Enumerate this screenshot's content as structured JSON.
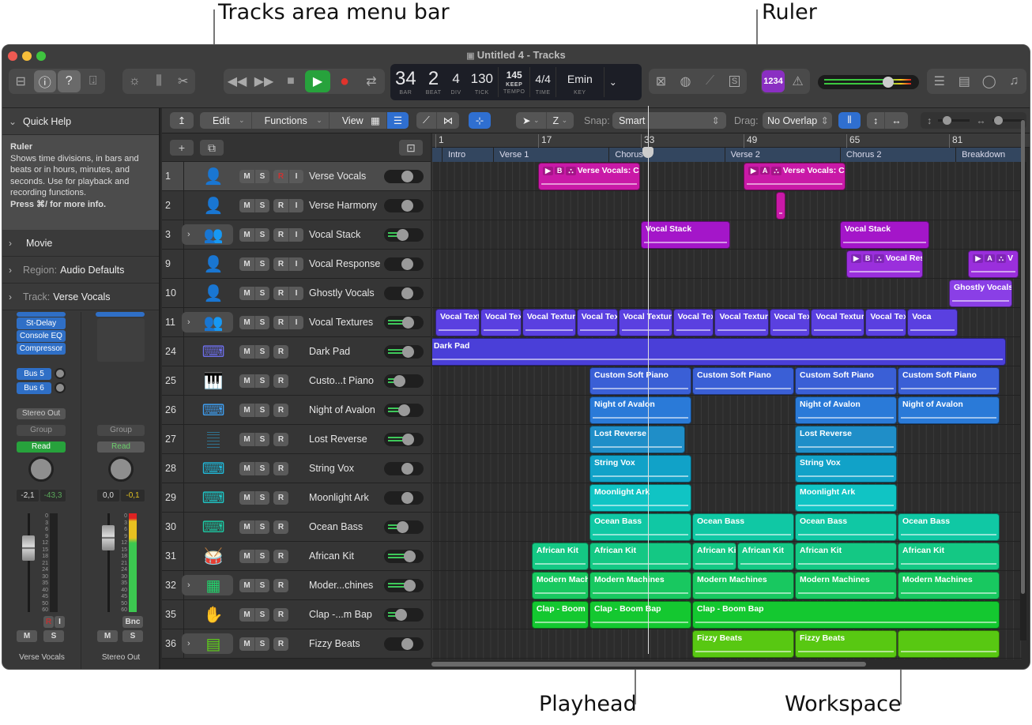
{
  "callouts": {
    "tracks_area_menu_bar": "Tracks area menu bar",
    "ruler": "Ruler",
    "playhead": "Playhead",
    "workspace": "Workspace"
  },
  "window": {
    "title": "Untitled 4 - Tracks"
  },
  "control_bar": {
    "lcd": {
      "bar": "34",
      "bar_label": "BAR",
      "beat": "2",
      "beat_label": "BEAT",
      "div": "4",
      "div_label": "DIV",
      "tick": "130",
      "tick_label": "TICK",
      "tempo": "145",
      "tempo_mode": "KEEP",
      "tempo_label": "TEMPO",
      "time_sig": "4/4",
      "time_label": "TIME",
      "key": "Emin",
      "key_label": "KEY"
    },
    "count_in": "1234",
    "master_level_fraction": 0.68,
    "accent_purple": "#8a2fc2",
    "play_green": "#27a23c",
    "record_red": "#e0332c"
  },
  "inspector": {
    "quick_help": {
      "header": "Quick Help",
      "title": "Ruler",
      "body": "Shows time divisions, in bars and beats or in hours, minutes, and seconds. Use for playback and recording functions.",
      "hint": "Press ⌘/ for more info."
    },
    "sections": [
      {
        "label": "Movie",
        "prefix": ""
      },
      {
        "label": "Audio Defaults",
        "prefix": "Region:"
      },
      {
        "label": "Verse Vocals",
        "prefix": "Track:"
      }
    ],
    "channel_strips": [
      {
        "name": "Verse Vocals",
        "plugins": [
          "St-Delay",
          "Console EQ",
          "Compressor"
        ],
        "sends": [
          "Bus 5",
          "Bus 6"
        ],
        "output": "Stereo Out",
        "group": "Group",
        "automation": "Read",
        "volume": "-2,1",
        "peak": "-43,3",
        "buttons": [
          "R",
          "I",
          "M",
          "S"
        ]
      },
      {
        "name": "Stereo Out",
        "plugins": [],
        "sends": [],
        "group": "Group",
        "automation": "Read",
        "volume": "0,0",
        "peak": "-0,1",
        "buttons": [
          "Bnc",
          "M",
          "S"
        ]
      }
    ],
    "meter_scale": [
      "0",
      "3",
      "6",
      "9",
      "12",
      "15",
      "18",
      "21",
      "24",
      "30",
      "35",
      "40",
      "45",
      "50",
      "60"
    ]
  },
  "tracks_menu": {
    "edit": "Edit",
    "functions": "Functions",
    "view": "View",
    "snap_label": "Snap:",
    "snap_value": "Smart",
    "drag_label": "Drag:",
    "drag_value": "No Overlap",
    "tool_right": "Z"
  },
  "ruler": {
    "bars": [
      "1",
      "17",
      "33",
      "49",
      "65",
      "81"
    ],
    "markers": [
      "Intro",
      "Verse 1",
      "Chorus 1",
      "Verse 2",
      "Chorus 2",
      "Breakdown"
    ]
  },
  "tracks": [
    {
      "num": "1",
      "name": "Verse Vocals",
      "icon": "vocalist-icon",
      "color": "#c418a8",
      "folder": false,
      "rec": true,
      "selected": true,
      "level": 0
    },
    {
      "num": "2",
      "name": "Verse Harmony",
      "icon": "vocalist-icon",
      "color": "#e23ad6",
      "folder": false,
      "rec": true,
      "level": 0
    },
    {
      "num": "3",
      "name": "Vocal Stack",
      "icon": "choir-icon",
      "color": "#c64ce0",
      "folder": true,
      "rec": true,
      "level": 0.5
    },
    {
      "num": "9",
      "name": "Vocal Response",
      "icon": "vocalist-icon",
      "color": "#b45cf0",
      "folder": false,
      "rec": true,
      "level": 0
    },
    {
      "num": "10",
      "name": "Ghostly Vocals",
      "icon": "vocalist-icon",
      "color": "#9a5ef2",
      "folder": false,
      "rec": true,
      "level": 0
    },
    {
      "num": "11",
      "name": "Vocal Textures",
      "icon": "choir-icon",
      "color": "#7a68f0",
      "folder": true,
      "rec": true,
      "level": 0.8
    },
    {
      "num": "24",
      "name": "Dark Pad",
      "icon": "synth-icon",
      "color": "#6c6ee8",
      "folder": false,
      "rec": false,
      "level": 0.8
    },
    {
      "num": "25",
      "name": "Custo...t Piano",
      "icon": "piano-icon",
      "color": "#5a86ee",
      "folder": false,
      "rec": false,
      "level": 0.3
    },
    {
      "num": "26",
      "name": "Night of Avalon",
      "icon": "keyboard-icon",
      "color": "#3f9ef0",
      "folder": false,
      "rec": false,
      "level": 0.6
    },
    {
      "num": "27",
      "name": "Lost Reverse",
      "icon": "sampler-icon",
      "color": "#2aaee8",
      "folder": false,
      "rec": false,
      "level": 0.8
    },
    {
      "num": "28",
      "name": "String Vox",
      "icon": "keyboard-icon",
      "color": "#20b8d8",
      "folder": false,
      "rec": false,
      "level": 0
    },
    {
      "num": "29",
      "name": "Moonlight Ark",
      "icon": "synth-icon",
      "color": "#1ec4c4",
      "folder": false,
      "rec": false,
      "level": 0
    },
    {
      "num": "30",
      "name": "Ocean Bass",
      "icon": "synth-icon",
      "color": "#1ccaa4",
      "folder": false,
      "rec": false,
      "level": 0.5
    },
    {
      "num": "31",
      "name": "African Kit",
      "icon": "djembe-icon",
      "color": "#1ed08a",
      "folder": false,
      "rec": false,
      "level": 0.9
    },
    {
      "num": "32",
      "name": "Moder...chines",
      "icon": "drum-machine-icon",
      "color": "#22d06a",
      "folder": true,
      "rec": false,
      "level": 0.9
    },
    {
      "num": "35",
      "name": "Clap -...m Bap",
      "icon": "hand-clap-icon",
      "color": "#2ed040",
      "folder": false,
      "rec": false,
      "level": 0.4
    },
    {
      "num": "36",
      "name": "Fizzy Beats",
      "icon": "beat-sequencer-icon",
      "color": "#5ed018",
      "folder": true,
      "rec": false,
      "level": 0
    }
  ],
  "regions": [
    {
      "lane": 0,
      "start": 17,
      "len": 16,
      "name": "Verse Vocals: Comp B",
      "takes": [
        "▶",
        "B",
        "⛬"
      ],
      "color": "#c919a7"
    },
    {
      "lane": 0,
      "start": 49,
      "len": 16,
      "name": "Verse Vocals: Comp A",
      "takes": [
        "▶",
        "A",
        "⛬"
      ],
      "color": "#c919a7"
    },
    {
      "lane": 1,
      "start": 54,
      "len": 1,
      "name": "",
      "color": "#c919a7"
    },
    {
      "lane": 2,
      "start": 33,
      "len": 14,
      "name": "Vocal Stack",
      "color": "#a416c9"
    },
    {
      "lane": 2,
      "start": 64,
      "len": 14,
      "name": "Vocal Stack",
      "color": "#a416c9"
    },
    {
      "lane": 3,
      "start": 65,
      "len": 12,
      "name": "Vocal Respon",
      "takes": [
        "▶",
        "B",
        "⛬"
      ],
      "color": "#9a2fdc"
    },
    {
      "lane": 3,
      "start": 84,
      "len": 8,
      "name": "V",
      "takes": [
        "▶",
        "A",
        "⛬"
      ],
      "color": "#9a2fdc"
    },
    {
      "lane": 4,
      "start": 81,
      "len": 10,
      "name": "Ghostly Vocals",
      "color": "#8a3fe6"
    },
    {
      "lane": 5,
      "start": 1,
      "len": 7,
      "name": "Vocal Textu",
      "color": "#5a40e0"
    },
    {
      "lane": 5,
      "start": 8,
      "len": 6.5,
      "name": "Vocal Text",
      "color": "#5a40e0"
    },
    {
      "lane": 5,
      "start": 14.5,
      "len": 8.5,
      "name": "Vocal Textures",
      "color": "#5a40e0"
    },
    {
      "lane": 5,
      "start": 23,
      "len": 6.5,
      "name": "Vocal Text",
      "color": "#5a40e0"
    },
    {
      "lane": 5,
      "start": 29.5,
      "len": 8.5,
      "name": "Vocal Textures",
      "color": "#5a40e0"
    },
    {
      "lane": 5,
      "start": 38,
      "len": 6.5,
      "name": "Vocal Text",
      "color": "#5a40e0"
    },
    {
      "lane": 5,
      "start": 44.5,
      "len": 8.5,
      "name": "Vocal Textures",
      "color": "#5a40e0"
    },
    {
      "lane": 5,
      "start": 53,
      "len": 6.5,
      "name": "Vocal Text",
      "color": "#5a40e0"
    },
    {
      "lane": 5,
      "start": 59.5,
      "len": 8.5,
      "name": "Vocal Textures",
      "color": "#5a40e0"
    },
    {
      "lane": 5,
      "start": 68,
      "len": 6.5,
      "name": "Vocal Text",
      "color": "#5a40e0"
    },
    {
      "lane": 5,
      "start": 74.5,
      "len": 8,
      "name": "Voca",
      "color": "#5a40e0"
    },
    {
      "lane": 6,
      "start": 0,
      "len": 90,
      "name": "Dark Pad",
      "color": "#4a3fd8"
    },
    {
      "lane": 7,
      "start": 25,
      "len": 16,
      "name": "Custom Soft Piano",
      "color": "#3a5fd6"
    },
    {
      "lane": 7,
      "start": 41,
      "len": 16,
      "name": "Custom Soft Piano",
      "color": "#3a5fd6"
    },
    {
      "lane": 7,
      "start": 57,
      "len": 16,
      "name": "Custom Soft Piano",
      "color": "#3a5fd6"
    },
    {
      "lane": 7,
      "start": 73,
      "len": 16,
      "name": "Custom Soft Piano",
      "color": "#3a5fd6"
    },
    {
      "lane": 8,
      "start": 25,
      "len": 16,
      "name": "Night of Avalon",
      "color": "#2a7ad8"
    },
    {
      "lane": 8,
      "start": 57,
      "len": 16,
      "name": "Night of Avalon",
      "color": "#2a7ad8"
    },
    {
      "lane": 8,
      "start": 73,
      "len": 16,
      "name": "Night of Avalon",
      "color": "#2a7ad8"
    },
    {
      "lane": 9,
      "start": 25,
      "len": 15,
      "name": "Lost Reverse",
      "color": "#1f8ec8"
    },
    {
      "lane": 9,
      "start": 57,
      "len": 16,
      "name": "Lost Reverse",
      "color": "#1f8ec8"
    },
    {
      "lane": 10,
      "start": 25,
      "len": 16,
      "name": "String Vox",
      "color": "#11a2c8"
    },
    {
      "lane": 10,
      "start": 57,
      "len": 16,
      "name": "String Vox",
      "color": "#11a2c8"
    },
    {
      "lane": 11,
      "start": 25,
      "len": 16,
      "name": "Moonlight Ark",
      "color": "#10c4c4"
    },
    {
      "lane": 11,
      "start": 57,
      "len": 16,
      "name": "Moonlight Ark",
      "color": "#10c4c4"
    },
    {
      "lane": 12,
      "start": 25,
      "len": 16,
      "name": "Ocean Bass",
      "color": "#10c8a4"
    },
    {
      "lane": 12,
      "start": 41,
      "len": 16,
      "name": "Ocean Bass",
      "color": "#10c8a4"
    },
    {
      "lane": 12,
      "start": 57,
      "len": 16,
      "name": "Ocean Bass",
      "color": "#10c8a4"
    },
    {
      "lane": 12,
      "start": 73,
      "len": 16,
      "name": "Ocean Bass",
      "color": "#10c8a4"
    },
    {
      "lane": 13,
      "start": 16,
      "len": 9,
      "name": "African Kit",
      "color": "#14c884"
    },
    {
      "lane": 13,
      "start": 25,
      "len": 16,
      "name": "African Kit",
      "color": "#14c884"
    },
    {
      "lane": 13,
      "start": 41,
      "len": 7,
      "name": "African Kit",
      "color": "#14c884"
    },
    {
      "lane": 13,
      "start": 48,
      "len": 9,
      "name": "African Kit",
      "color": "#14c884"
    },
    {
      "lane": 13,
      "start": 57,
      "len": 16,
      "name": "African Kit",
      "color": "#14c884"
    },
    {
      "lane": 13,
      "start": 73,
      "len": 16,
      "name": "African Kit",
      "color": "#14c884"
    },
    {
      "lane": 14,
      "start": 16,
      "len": 9,
      "name": "Modern Machin",
      "color": "#18c860"
    },
    {
      "lane": 14,
      "start": 25,
      "len": 16,
      "name": "Modern Machines",
      "color": "#18c860"
    },
    {
      "lane": 14,
      "start": 41,
      "len": 16,
      "name": "Modern Machines",
      "color": "#18c860"
    },
    {
      "lane": 14,
      "start": 57,
      "len": 16,
      "name": "Modern Machines",
      "color": "#18c860"
    },
    {
      "lane": 14,
      "start": 73,
      "len": 16,
      "name": "Modern Machines",
      "color": "#18c860"
    },
    {
      "lane": 15,
      "start": 16,
      "len": 9,
      "name": "Clap - Boom B",
      "color": "#14c830"
    },
    {
      "lane": 15,
      "start": 25,
      "len": 16,
      "name": "Clap - Boom Bap",
      "color": "#14c830"
    },
    {
      "lane": 15,
      "start": 41,
      "len": 48,
      "name": "Clap - Boom Bap",
      "color": "#14c830"
    },
    {
      "lane": 16,
      "start": 41,
      "len": 16,
      "name": "Fizzy Beats",
      "color": "#58c812"
    },
    {
      "lane": 16,
      "start": 57,
      "len": 16,
      "name": "Fizzy Beats",
      "color": "#58c812"
    },
    {
      "lane": 16,
      "start": 73,
      "len": 16,
      "name": "",
      "color": "#58c812"
    }
  ],
  "playhead_bar": 34.2
}
